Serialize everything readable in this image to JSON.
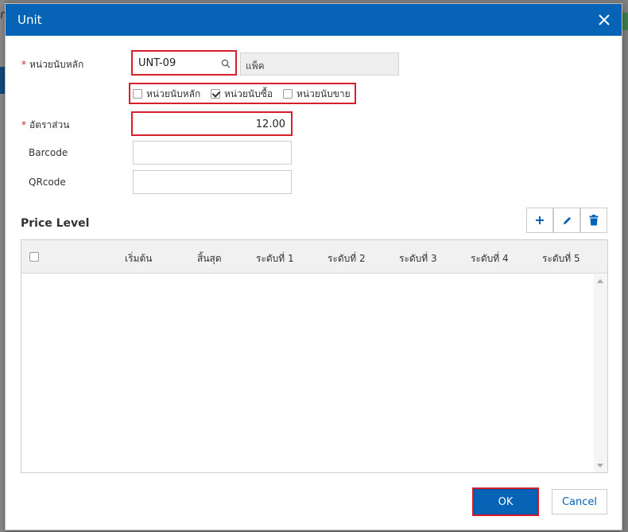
{
  "background": {
    "glyph": "ก"
  },
  "dialog": {
    "title": "Unit",
    "fields": {
      "main_unit_label": "หน่วยนับหลัก",
      "main_unit_code": "UNT-09",
      "main_unit_name": "แพ็ค",
      "ratio_label": "อัตราส่วน",
      "ratio_value": "12.00",
      "barcode_label": "Barcode",
      "barcode_value": "",
      "qrcode_label": "QRcode",
      "qrcode_value": ""
    },
    "unit_type_options": [
      {
        "label": "หน่วยนับหลัก",
        "checked": false
      },
      {
        "label": "หน่วยนับซื้อ",
        "checked": true
      },
      {
        "label": "หน่วยนับขาย",
        "checked": false
      }
    ],
    "price_level": {
      "title": "Price Level",
      "columns": [
        "เริ่มต้น",
        "สิ้นสุด",
        "ระดับที่ 1",
        "ระดับที่ 2",
        "ระดับที่ 3",
        "ระดับที่ 4",
        "ระดับที่ 5"
      ],
      "rows": []
    },
    "buttons": {
      "ok": "OK",
      "cancel": "Cancel"
    },
    "colors": {
      "header": "#0663b5",
      "highlight": "#d51f2d",
      "required": "#d02030"
    }
  }
}
